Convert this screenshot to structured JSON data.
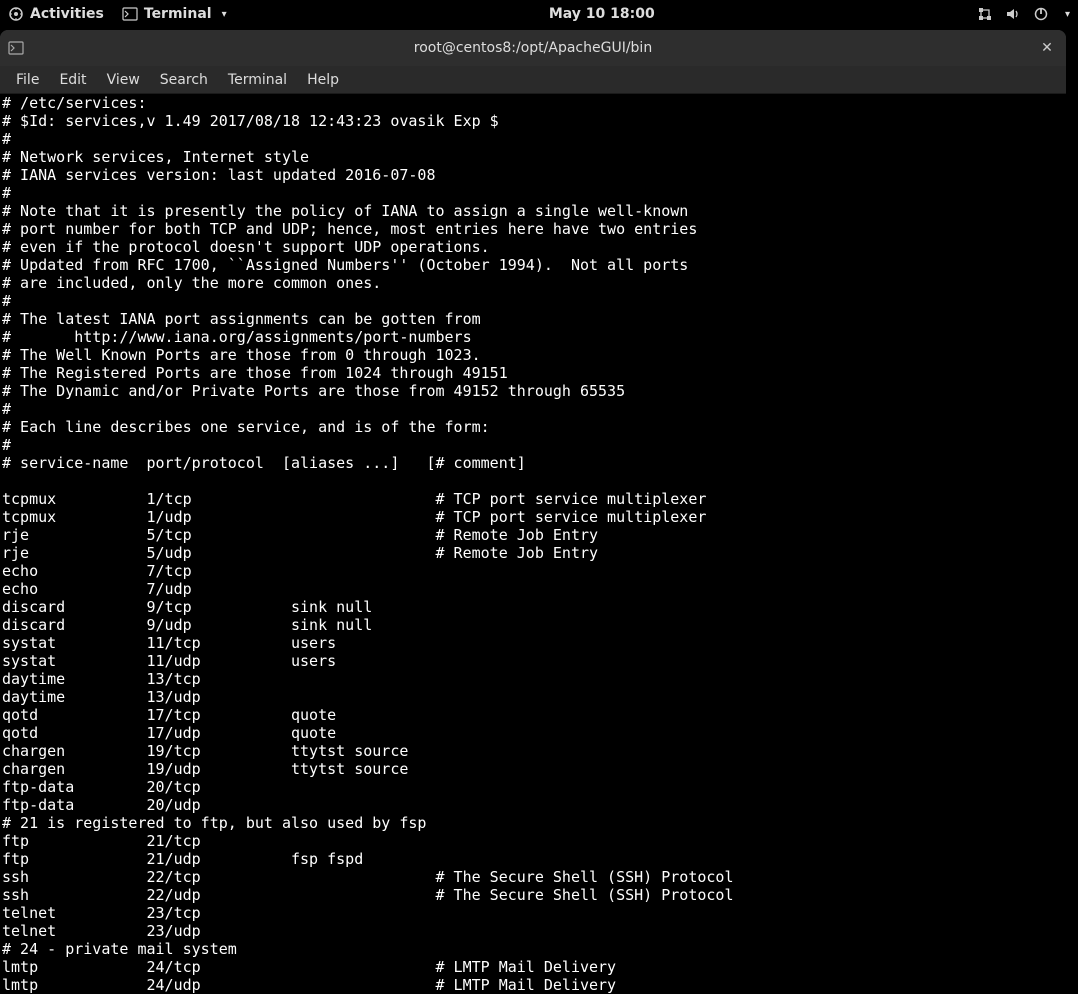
{
  "panel": {
    "activities_label": "Activities",
    "terminal_label": "Terminal",
    "clock": "May 10  18:00"
  },
  "window": {
    "title": "root@centos8:/opt/ApacheGUI/bin"
  },
  "menubar": {
    "items": [
      "File",
      "Edit",
      "View",
      "Search",
      "Terminal",
      "Help"
    ]
  },
  "terminal": {
    "lines": [
      "# /etc/services:",
      "# $Id: services,v 1.49 2017/08/18 12:43:23 ovasik Exp $",
      "#",
      "# Network services, Internet style",
      "# IANA services version: last updated 2016-07-08",
      "#",
      "# Note that it is presently the policy of IANA to assign a single well-known",
      "# port number for both TCP and UDP; hence, most entries here have two entries",
      "# even if the protocol doesn't support UDP operations.",
      "# Updated from RFC 1700, ``Assigned Numbers'' (October 1994).  Not all ports",
      "# are included, only the more common ones.",
      "#",
      "# The latest IANA port assignments can be gotten from",
      "#       http://www.iana.org/assignments/port-numbers",
      "# The Well Known Ports are those from 0 through 1023.",
      "# The Registered Ports are those from 1024 through 49151",
      "# The Dynamic and/or Private Ports are those from 49152 through 65535",
      "#",
      "# Each line describes one service, and is of the form:",
      "#",
      "# service-name  port/protocol  [aliases ...]   [# comment]",
      "",
      "tcpmux          1/tcp                           # TCP port service multiplexer",
      "tcpmux          1/udp                           # TCP port service multiplexer",
      "rje             5/tcp                           # Remote Job Entry",
      "rje             5/udp                           # Remote Job Entry",
      "echo            7/tcp",
      "echo            7/udp",
      "discard         9/tcp           sink null",
      "discard         9/udp           sink null",
      "systat          11/tcp          users",
      "systat          11/udp          users",
      "daytime         13/tcp",
      "daytime         13/udp",
      "qotd            17/tcp          quote",
      "qotd            17/udp          quote",
      "chargen         19/tcp          ttytst source",
      "chargen         19/udp          ttytst source",
      "ftp-data        20/tcp",
      "ftp-data        20/udp",
      "# 21 is registered to ftp, but also used by fsp",
      "ftp             21/tcp",
      "ftp             21/udp          fsp fspd",
      "ssh             22/tcp                          # The Secure Shell (SSH) Protocol",
      "ssh             22/udp                          # The Secure Shell (SSH) Protocol",
      "telnet          23/tcp",
      "telnet          23/udp",
      "# 24 - private mail system",
      "lmtp            24/tcp                          # LMTP Mail Delivery",
      "lmtp            24/udp                          # LMTP Mail Delivery"
    ]
  }
}
